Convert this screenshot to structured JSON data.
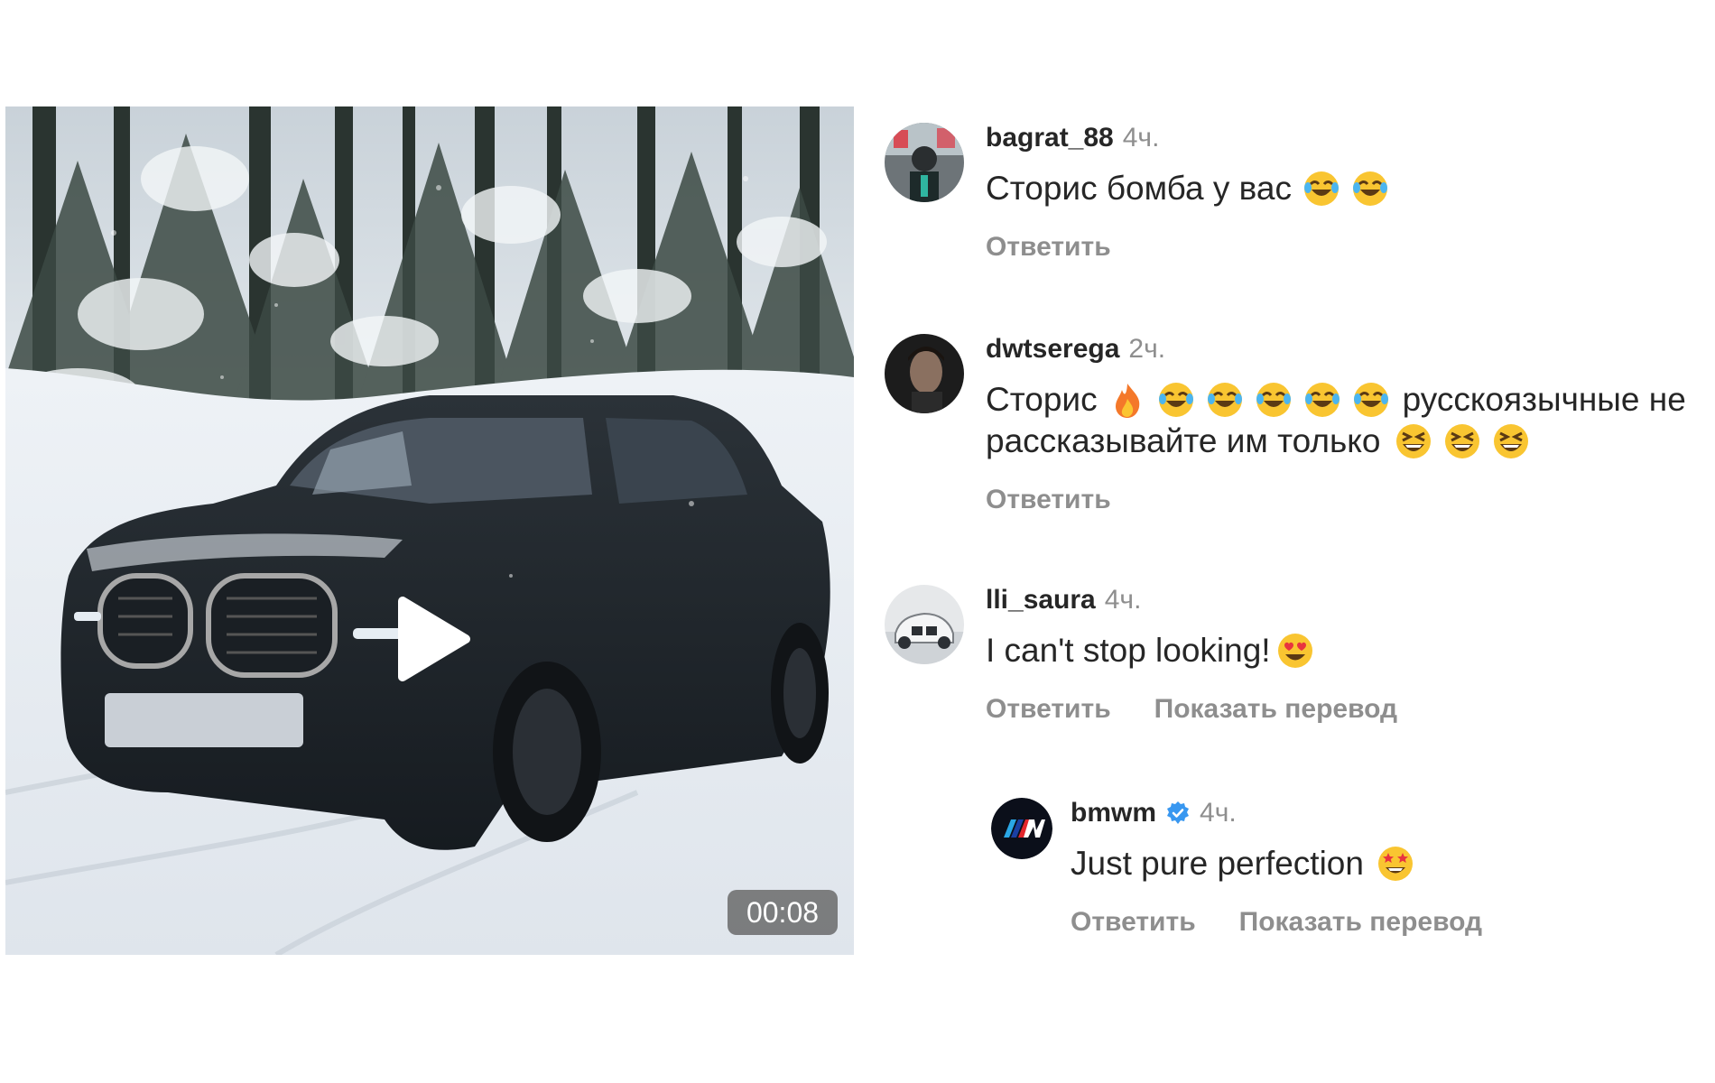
{
  "video": {
    "duration": "00:08",
    "play_icon": "play-icon"
  },
  "comments": [
    {
      "username": "bagrat_88",
      "time": "4ч.",
      "text": "Сторис бомба у вас",
      "emojis": [
        "face-with-tears-of-joy",
        "face-with-tears-of-joy"
      ],
      "actions": [
        "Ответить"
      ]
    },
    {
      "username": "dwtserega",
      "time": "2ч.",
      "text_line1": "Сторис",
      "emojis_line1": [
        "fire",
        "face-with-tears-of-joy",
        "face-with-tears-of-joy",
        "face-with-tears-of-joy",
        "face-with-tears-of-joy",
        "face-with-tears-of-joy"
      ],
      "text_line1_after": "русскоязычные не",
      "text_line2": "рассказывайте им только",
      "emojis_line2": [
        "grinning-squinting-face",
        "grinning-squinting-face",
        "grinning-squinting-face"
      ],
      "actions": [
        "Ответить"
      ]
    },
    {
      "username": "lli_saura",
      "time": "4ч.",
      "text": "I can't stop looking!",
      "emojis": [
        "smiling-face-with-heart-eyes"
      ],
      "actions": [
        "Ответить",
        "Показать перевод"
      ]
    },
    {
      "username": "bmwm",
      "verified": true,
      "time": "4ч.",
      "text": "Just pure perfection",
      "emojis": [
        "star-struck"
      ],
      "actions": [
        "Ответить",
        "Показать перевод"
      ]
    }
  ],
  "colors": {
    "username": "#262626",
    "secondary": "#8e8e8e",
    "verified": "#3897f0",
    "duration_bg": "#5f5f5f"
  }
}
